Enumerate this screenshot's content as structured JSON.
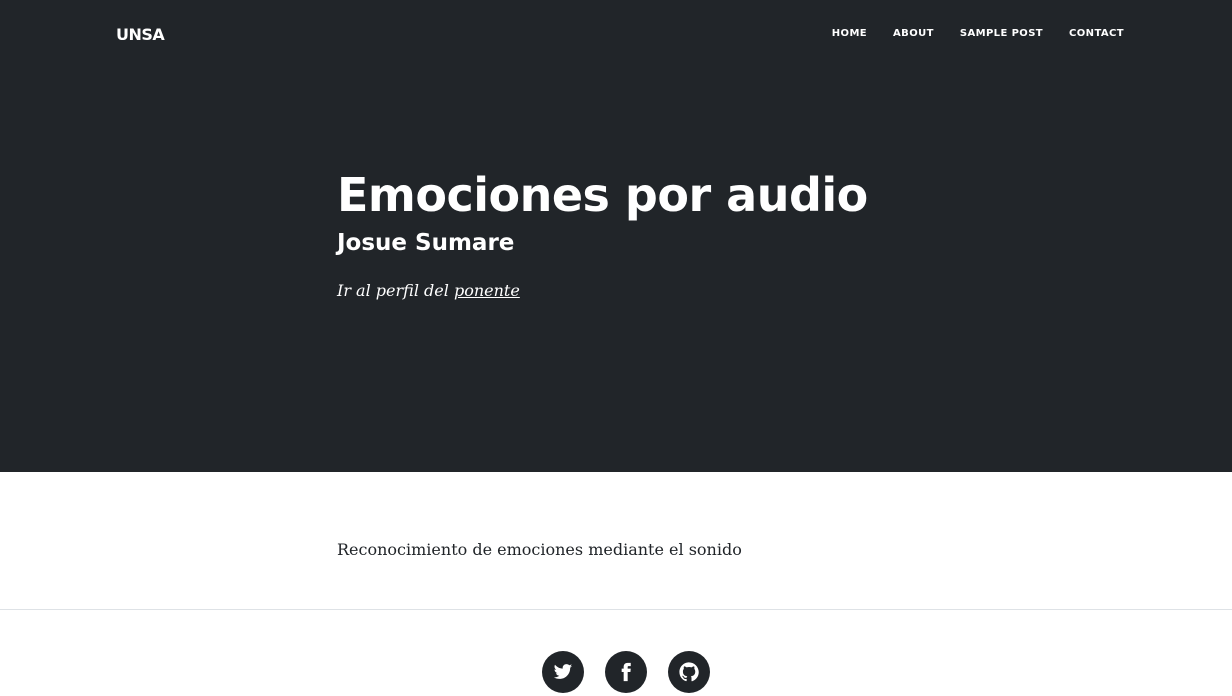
{
  "nav": {
    "brand": "UNSA",
    "items": [
      {
        "label": "HOME"
      },
      {
        "label": "ABOUT"
      },
      {
        "label": "SAMPLE POST"
      },
      {
        "label": "CONTACT"
      }
    ]
  },
  "post": {
    "title": "Emociones por audio",
    "subtitle": "Josue Sumare",
    "meta_prefix": "Ir al perfil del ",
    "meta_link": "ponente",
    "body": "Reconocimiento de emociones mediante el sonido"
  },
  "footer": {
    "social": [
      {
        "icon": "twitter-icon"
      },
      {
        "icon": "facebook-icon"
      },
      {
        "icon": "github-icon"
      }
    ]
  },
  "colors": {
    "masthead_bg": "#212529",
    "text": "#212529",
    "white": "#ffffff",
    "divider": "#dee2e6"
  }
}
